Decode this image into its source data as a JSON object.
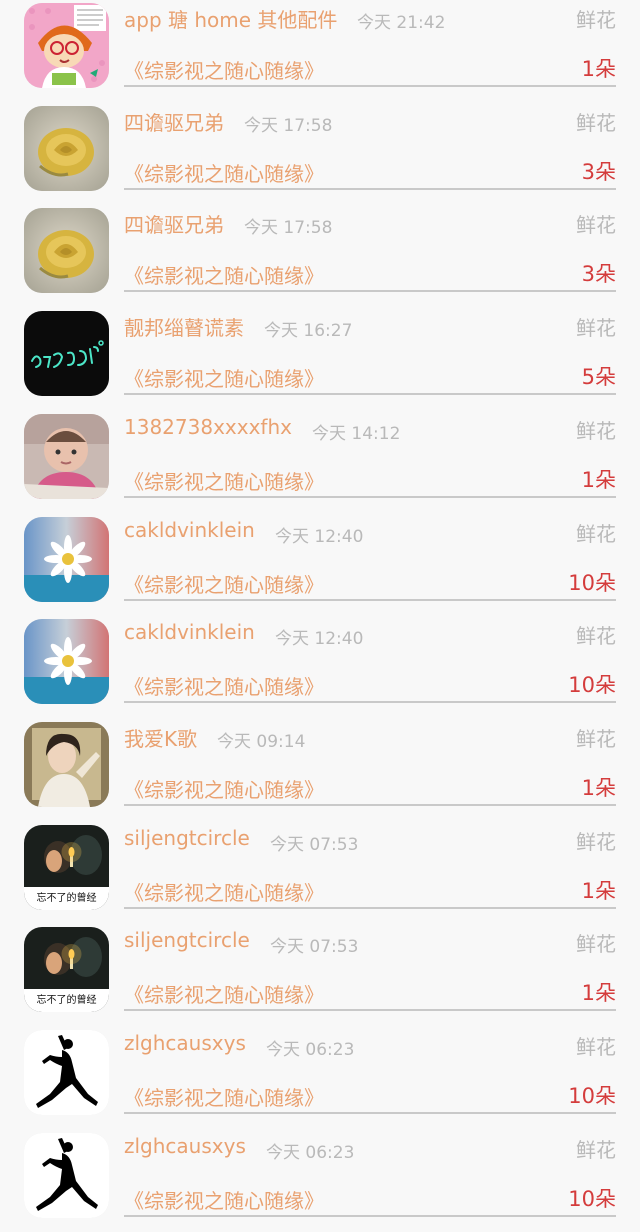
{
  "gift_list": [
    {
      "name": "app 瑭 home 其他配件",
      "time": "今天 21:42",
      "gift_type": "鲜花",
      "title": "《综影视之随心随缘》",
      "count": "1朵",
      "avatar_icon": "cartoon-girl-avatar-icon"
    },
    {
      "name": "四谵驱兄弟",
      "time": "今天 17:58",
      "gift_type": "鲜花",
      "title": "《综影视之随心随缘》",
      "count": "3朵",
      "avatar_icon": "yellow-rose-avatar-icon"
    },
    {
      "name": "四谵驱兄弟",
      "time": "今天 17:58",
      "gift_type": "鲜花",
      "title": "《综影视之随心随缘》",
      "count": "3朵",
      "avatar_icon": "yellow-rose-avatar-icon"
    },
    {
      "name": "靓邦缁瞽谎素",
      "time": "今天 16:27",
      "gift_type": "鲜花",
      "title": "《综影视之随心随缘》",
      "count": "5朵",
      "avatar_icon": "black-neon-text-avatar-icon"
    },
    {
      "name": "1382738xxxxfhx",
      "time": "今天 14:12",
      "gift_type": "鲜花",
      "title": "《综影视之随心随缘》",
      "count": "1朵",
      "avatar_icon": "baby-photo-avatar-icon"
    },
    {
      "name": "cakldvinklein",
      "time": "今天 12:40",
      "gift_type": "鲜花",
      "title": "《综影视之随心随缘》",
      "count": "10朵",
      "avatar_icon": "daisy-avatar-icon"
    },
    {
      "name": "cakldvinklein",
      "time": "今天 12:40",
      "gift_type": "鲜花",
      "title": "《综影视之随心随缘》",
      "count": "10朵",
      "avatar_icon": "daisy-avatar-icon"
    },
    {
      "name": "我爱K歌",
      "time": "今天 09:14",
      "gift_type": "鲜花",
      "title": "《综影视之随心随缘》",
      "count": "1朵",
      "avatar_icon": "woman-portrait-avatar-icon"
    },
    {
      "name": "siljengtcircle",
      "time": "今天 07:53",
      "gift_type": "鲜花",
      "title": "《综影视之随心随缘》",
      "count": "1朵",
      "avatar_icon": "candle-couple-avatar-icon",
      "avatar_caption": "忘不了的曾经"
    },
    {
      "name": "siljengtcircle",
      "time": "今天 07:53",
      "gift_type": "鲜花",
      "title": "《综影视之随心随缘》",
      "count": "1朵",
      "avatar_icon": "candle-couple-avatar-icon",
      "avatar_caption": "忘不了的曾经"
    },
    {
      "name": "zlghcausxys",
      "time": "今天 06:23",
      "gift_type": "鲜花",
      "title": "《综影视之随心随缘》",
      "count": "10朵",
      "avatar_icon": "jumpman-logo-avatar-icon"
    },
    {
      "name": "zlghcausxys",
      "time": "今天 06:23",
      "gift_type": "鲜花",
      "title": "《综影视之随心随缘》",
      "count": "10朵",
      "avatar_icon": "jumpman-logo-avatar-icon"
    }
  ],
  "colors": {
    "name": "#e9a170",
    "time": "#b9b9b9",
    "count": "#d43c3c",
    "divider": "#c9c9c9"
  }
}
